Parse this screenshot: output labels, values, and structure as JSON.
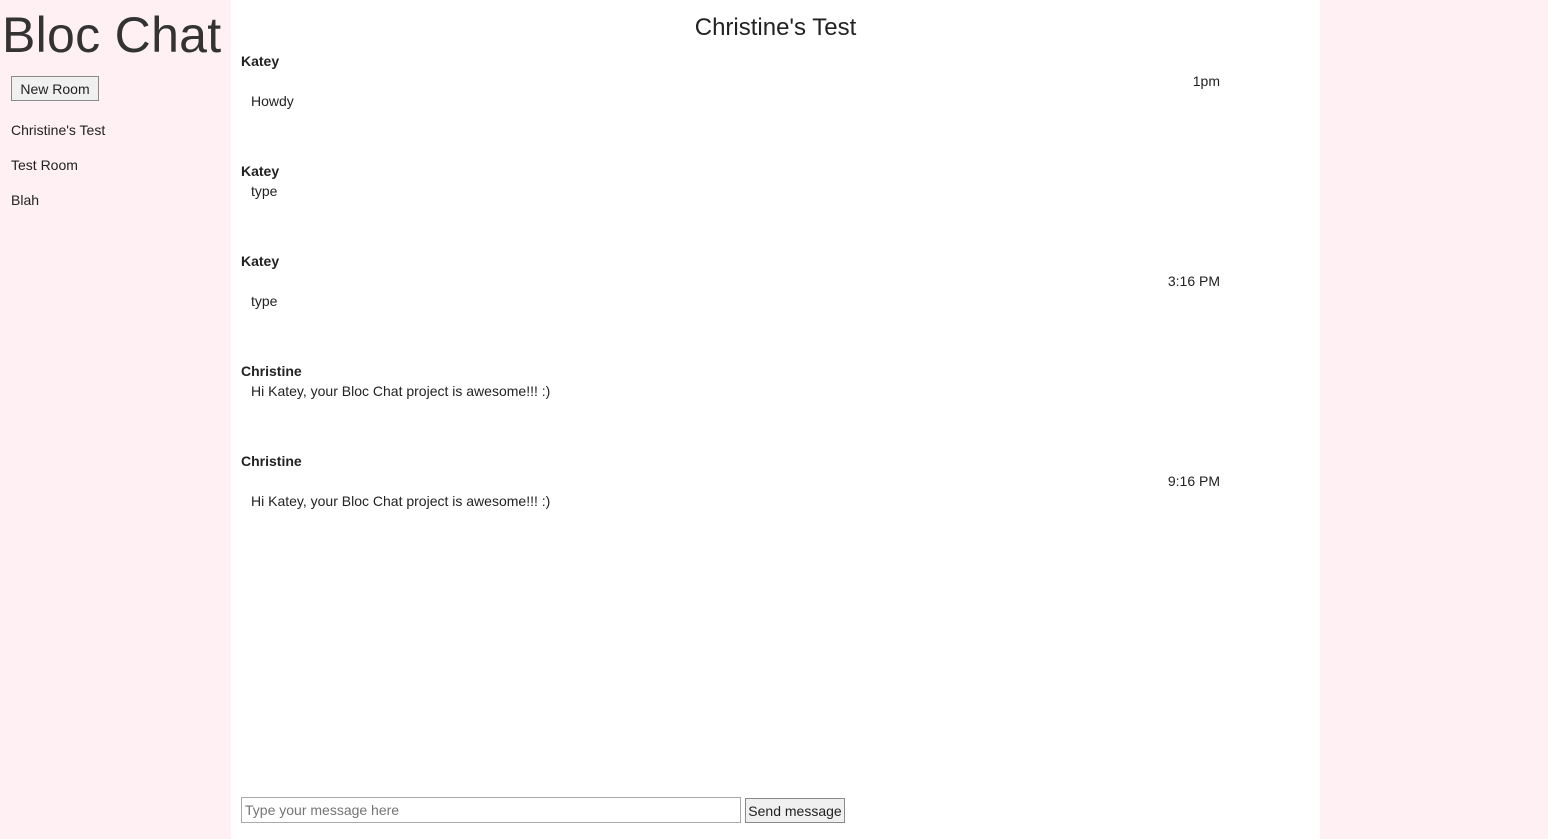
{
  "sidebar": {
    "app_title": "Bloc Chat",
    "new_room_label": "New Room",
    "rooms": [
      {
        "name": "Christine's Test"
      },
      {
        "name": "Test Room"
      },
      {
        "name": "Blah"
      }
    ]
  },
  "main": {
    "room_title": "Christine's Test",
    "messages": [
      {
        "username": "Katey",
        "sent_at": "1pm",
        "content": "Howdy"
      },
      {
        "username": "Katey",
        "sent_at": "",
        "content": "type"
      },
      {
        "username": "Katey",
        "sent_at": "3:16 PM",
        "content": "type"
      },
      {
        "username": "Christine",
        "sent_at": "",
        "content": "Hi Katey, your Bloc Chat project is awesome!!! :)"
      },
      {
        "username": "Christine",
        "sent_at": "9:16 PM",
        "content": "Hi Katey, your Bloc Chat project is awesome!!! :)"
      }
    ],
    "composer": {
      "placeholder": "Type your message here",
      "value": "",
      "send_label": "Send message"
    }
  },
  "colors": {
    "sidebar_background": "#fff0f4",
    "main_background": "#ffffff",
    "text": "#222222"
  }
}
